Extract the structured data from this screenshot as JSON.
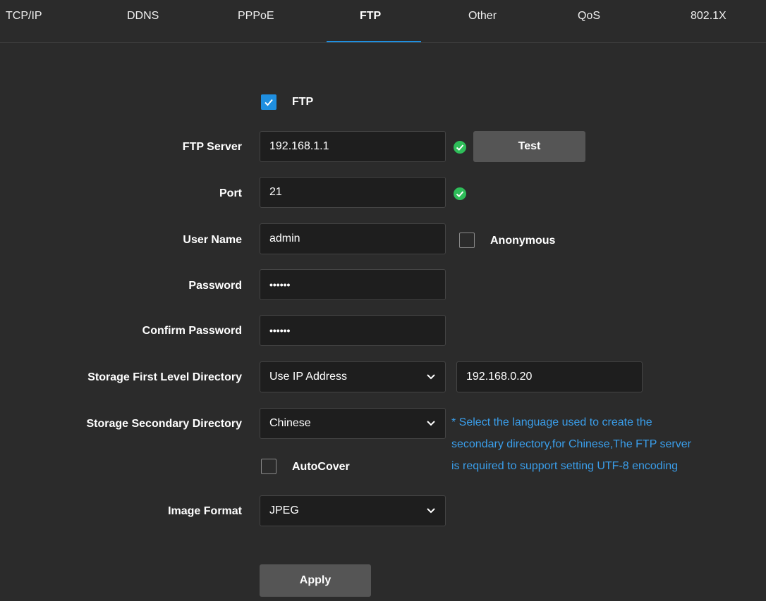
{
  "tabs": [
    {
      "label": "TCP/IP"
    },
    {
      "label": "DDNS"
    },
    {
      "label": "PPPoE"
    },
    {
      "label": "FTP"
    },
    {
      "label": "Other"
    },
    {
      "label": "QoS"
    },
    {
      "label": "802.1X"
    }
  ],
  "active_tab": "FTP",
  "form": {
    "ftp_enable": {
      "label": "FTP",
      "checked": true
    },
    "ftp_server": {
      "label": "FTP Server",
      "value": "192.168.1.1",
      "test_label": "Test"
    },
    "port": {
      "label": "Port",
      "value": "21"
    },
    "user_name": {
      "label": "User Name",
      "value": "admin",
      "anonymous_label": "Anonymous",
      "anonymous_checked": false
    },
    "password": {
      "label": "Password",
      "value": "••••••"
    },
    "confirm_password": {
      "label": "Confirm Password",
      "value": "••••••"
    },
    "storage_first": {
      "label": "Storage First Level Directory",
      "selected": "Use IP Address",
      "value": "192.168.0.20"
    },
    "storage_secondary": {
      "label": "Storage Secondary Directory",
      "selected": "Chinese"
    },
    "note_lines": [
      "* Select the language used to create the",
      "secondary directory,for Chinese,The FTP server",
      "is required to support setting UTF-8 encoding"
    ],
    "autocover": {
      "label": "AutoCover",
      "checked": false
    },
    "image_format": {
      "label": "Image Format",
      "selected": "JPEG"
    },
    "apply_label": "Apply"
  },
  "colors": {
    "background": "#2b2b2b",
    "accent": "#1f8fe0",
    "valid": "#2ebd59",
    "note": "#3a9eea"
  }
}
